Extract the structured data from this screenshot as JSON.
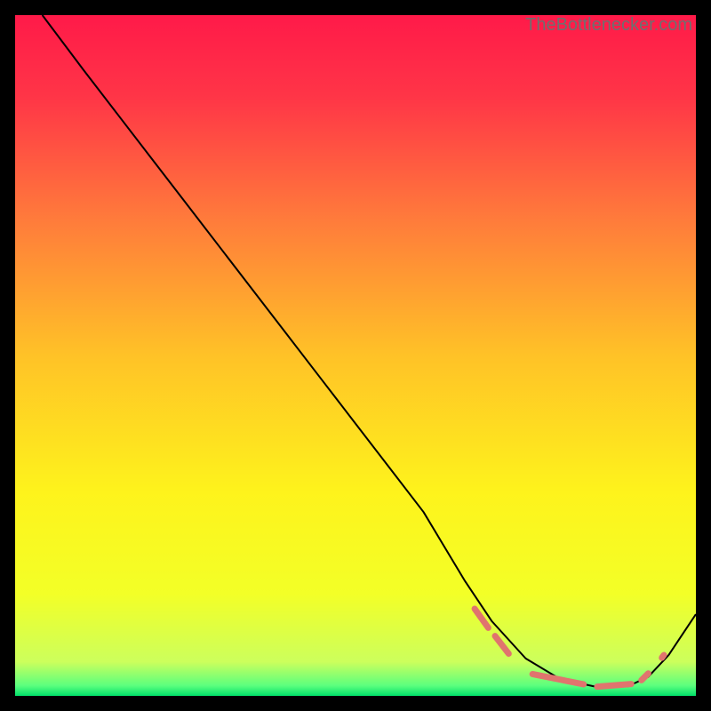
{
  "watermark": "TheBottlenecker.com",
  "chart_data": {
    "type": "line",
    "title": "",
    "xlabel": "",
    "ylabel": "",
    "xlim": [
      0,
      100
    ],
    "ylim": [
      0,
      100
    ],
    "grid": false,
    "legend": false,
    "background_gradient": {
      "stops": [
        {
          "offset": 0.0,
          "color": "#ff1a49"
        },
        {
          "offset": 0.12,
          "color": "#ff3547"
        },
        {
          "offset": 0.3,
          "color": "#ff7b3b"
        },
        {
          "offset": 0.5,
          "color": "#ffc227"
        },
        {
          "offset": 0.7,
          "color": "#fef31c"
        },
        {
          "offset": 0.85,
          "color": "#f3ff27"
        },
        {
          "offset": 0.95,
          "color": "#ccff5c"
        },
        {
          "offset": 0.985,
          "color": "#5bff7e"
        },
        {
          "offset": 1.0,
          "color": "#00e06a"
        }
      ]
    },
    "series": [
      {
        "name": "curve",
        "stroke": "#000000",
        "stroke_width": 2,
        "x": [
          4,
          7,
          10,
          15,
          20,
          25,
          30,
          35,
          40,
          45,
          50,
          55,
          60,
          63,
          66,
          70,
          75,
          80,
          85,
          90,
          93,
          96,
          100
        ],
        "y": [
          100,
          96,
          92,
          85.5,
          79,
          72.5,
          66,
          59.5,
          53,
          46.5,
          40,
          33.5,
          27,
          22,
          17,
          11,
          5.5,
          2.5,
          1.4,
          1.4,
          2.8,
          6,
          12
        ]
      },
      {
        "name": "marker-segments",
        "stroke": "#e0746e",
        "stroke_width": 7,
        "linecap": "round",
        "segments": [
          {
            "x": [
              67.5,
              69.5
            ],
            "y": [
              12.8,
              10.0
            ]
          },
          {
            "x": [
              70.5,
              72.5
            ],
            "y": [
              8.8,
              6.2
            ]
          },
          {
            "x": [
              76.0,
              83.5
            ],
            "y": [
              3.2,
              1.7
            ]
          },
          {
            "x": [
              85.5,
              90.5
            ],
            "y": [
              1.35,
              1.75
            ]
          },
          {
            "x": [
              92.0,
              93.0
            ],
            "y": [
              2.3,
              3.3
            ]
          },
          {
            "x": [
              95.0,
              95.3
            ],
            "y": [
              5.6,
              6.0
            ]
          }
        ]
      }
    ]
  }
}
